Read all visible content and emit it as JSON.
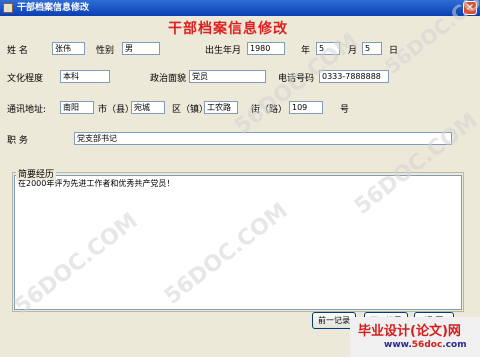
{
  "window": {
    "title": "干部档案信息修改",
    "close_glyph": "×"
  },
  "form": {
    "heading": "干部档案信息修改",
    "name_label": "姓    名",
    "name_value": "张伟",
    "gender_label": "性别",
    "gender_value": "男",
    "birth_label": "出生年月",
    "birth_year": "1980",
    "year_label": "年",
    "birth_month": "5",
    "month_label": "月",
    "birth_day": "5",
    "day_label": "日",
    "education_label": "文化程度",
    "education_value": "本科",
    "political_label": "政治面貌",
    "political_value": "党员",
    "phone_label": "电话号码",
    "phone_value": "0333-7888888",
    "address_label": "通讯地址:",
    "city_value": "南阳",
    "city_label": "市（县）",
    "district_value": "宛城",
    "district_label": "区（镇）",
    "street_value": "工农路",
    "street_label": "街（路）",
    "number_value": "109",
    "number_label": "号",
    "position_label": "职    务",
    "position_value": "党支部书记",
    "resume_label": "简要经历",
    "resume_text": "在2000年评为先进工作者和优秀共产党员！"
  },
  "buttons": {
    "prev": "前一记录",
    "next": "下一记录",
    "back": "返 回"
  },
  "watermark": {
    "text": "56DOC.COM",
    "site_cn": "毕业设计(论文)网",
    "site_url_main": "www.",
    "site_url_accent": "56doc",
    "site_url_end": ".com"
  },
  "colors": {
    "title_bar": "#0a3fb4",
    "heading_red": "#e02020",
    "window_bg": "#ece9d8"
  }
}
